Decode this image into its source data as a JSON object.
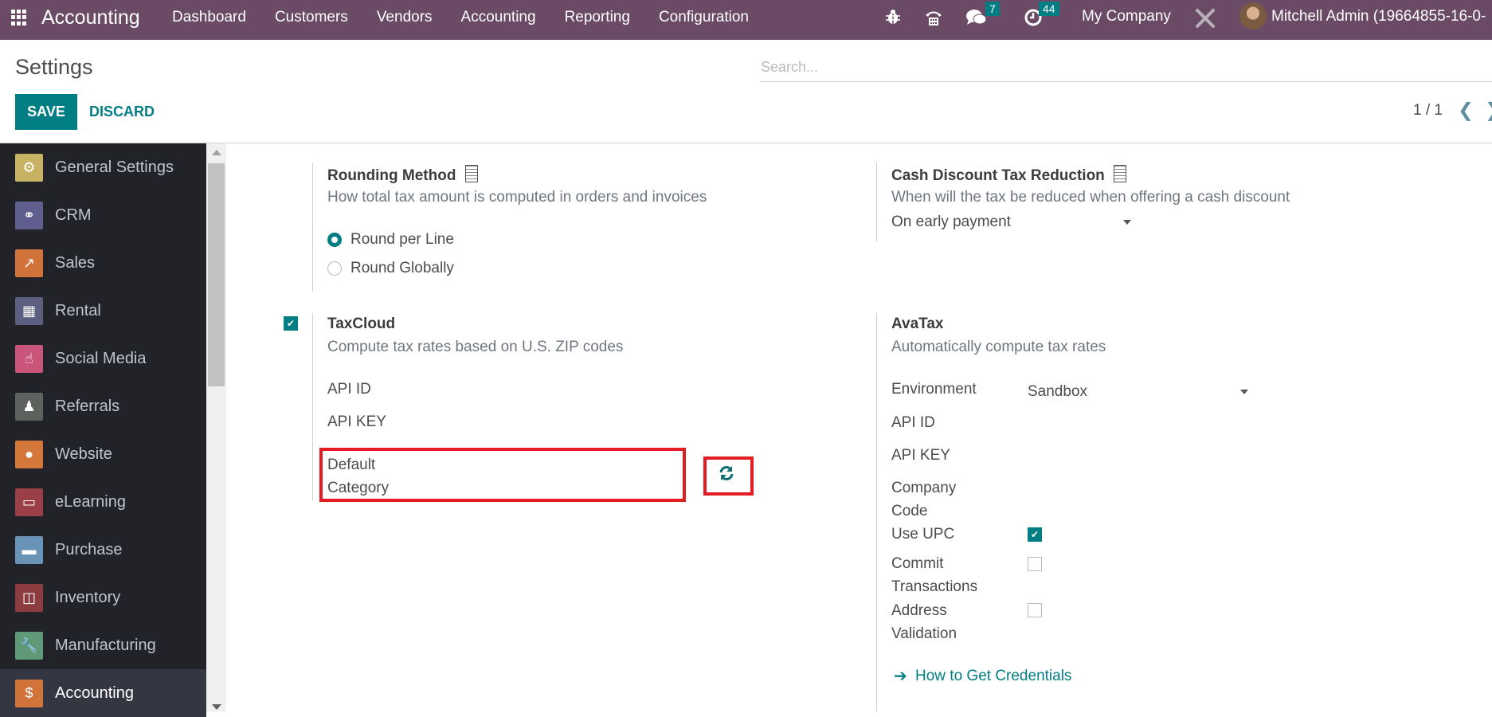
{
  "navbar": {
    "app_name": "Accounting",
    "menu": [
      "Dashboard",
      "Customers",
      "Vendors",
      "Accounting",
      "Reporting",
      "Configuration"
    ],
    "icons": [
      "bug-icon",
      "phone-icon",
      "chat-icon",
      "activity-clock-icon",
      "tools-icon"
    ],
    "messages_count": "7",
    "activities_count": "44",
    "company": "My Company",
    "user": "Mitchell Admin (19664855-16-0-"
  },
  "control_panel": {
    "title": "Settings",
    "search_placeholder": "Search...",
    "save_label": "SAVE",
    "discard_label": "DISCARD",
    "pager": "1 / 1"
  },
  "sidebar": {
    "items": [
      {
        "label": "General Settings",
        "icon": "gear-icon",
        "color": "#c7b264",
        "glyph": "⚙"
      },
      {
        "label": "CRM",
        "icon": "handshake-icon",
        "color": "#5f5f8f",
        "glyph": "🤝"
      },
      {
        "label": "Sales",
        "icon": "chart-up-icon",
        "color": "#d0743c",
        "glyph": "📈"
      },
      {
        "label": "Rental",
        "icon": "calendar-table-icon",
        "color": "#5c5f80",
        "glyph": "▦"
      },
      {
        "label": "Social Media",
        "icon": "thumbs-up-icon",
        "color": "#c9557a",
        "glyph": "👍"
      },
      {
        "label": "Referrals",
        "icon": "person-icon",
        "color": "#5e625e",
        "glyph": "♟"
      },
      {
        "label": "Website",
        "icon": "globe-icon",
        "color": "#d3773a",
        "glyph": "🌐"
      },
      {
        "label": "eLearning",
        "icon": "presentation-icon",
        "color": "#9a3f48",
        "glyph": "🖥"
      },
      {
        "label": "Purchase",
        "icon": "credit-card-icon",
        "color": "#6a93b8",
        "glyph": "💳"
      },
      {
        "label": "Inventory",
        "icon": "box-icon",
        "color": "#8c3b3f",
        "glyph": "📦"
      },
      {
        "label": "Manufacturing",
        "icon": "wrench-icon",
        "color": "#5e9a78",
        "glyph": "🔧"
      },
      {
        "label": "Accounting",
        "icon": "invoice-dollar-icon",
        "color": "#d0743c",
        "glyph": "$",
        "active": true
      }
    ]
  },
  "settings": {
    "rounding": {
      "title": "Rounding Method",
      "description": "How total tax amount is computed in orders and invoices",
      "options": [
        {
          "label": "Round per Line",
          "selected": true
        },
        {
          "label": "Round Globally",
          "selected": false
        }
      ]
    },
    "cash_discount": {
      "title": "Cash Discount Tax Reduction",
      "description": "When will the tax be reduced when offering a cash discount",
      "value": "On early payment"
    },
    "taxcloud": {
      "enabled": true,
      "title": "TaxCloud",
      "description": "Compute tax rates based on U.S. ZIP codes",
      "api_id_label": "API ID",
      "api_key_label": "API KEY",
      "default_category_label_1": "Default",
      "default_category_label_2": "Category"
    },
    "avatax": {
      "title": "AvaTax",
      "description": "Automatically compute tax rates",
      "environment_label": "Environment",
      "environment_value": "Sandbox",
      "api_id_label": "API ID",
      "api_key_label": "API KEY",
      "company_code_label_1": "Company",
      "company_code_label_2": "Code",
      "use_upc_label": "Use UPC",
      "use_upc": true,
      "commit_label_1": "Commit",
      "commit_label_2": "Transactions",
      "commit": false,
      "address_label_1": "Address",
      "address_label_2": "Validation",
      "address_validation": false,
      "credentials_link": "How to Get Credentials"
    }
  },
  "colors": {
    "navbar": "#6b4a66",
    "primary": "#017e84",
    "sidebar": "#212329",
    "highlight": "#e31b23"
  }
}
